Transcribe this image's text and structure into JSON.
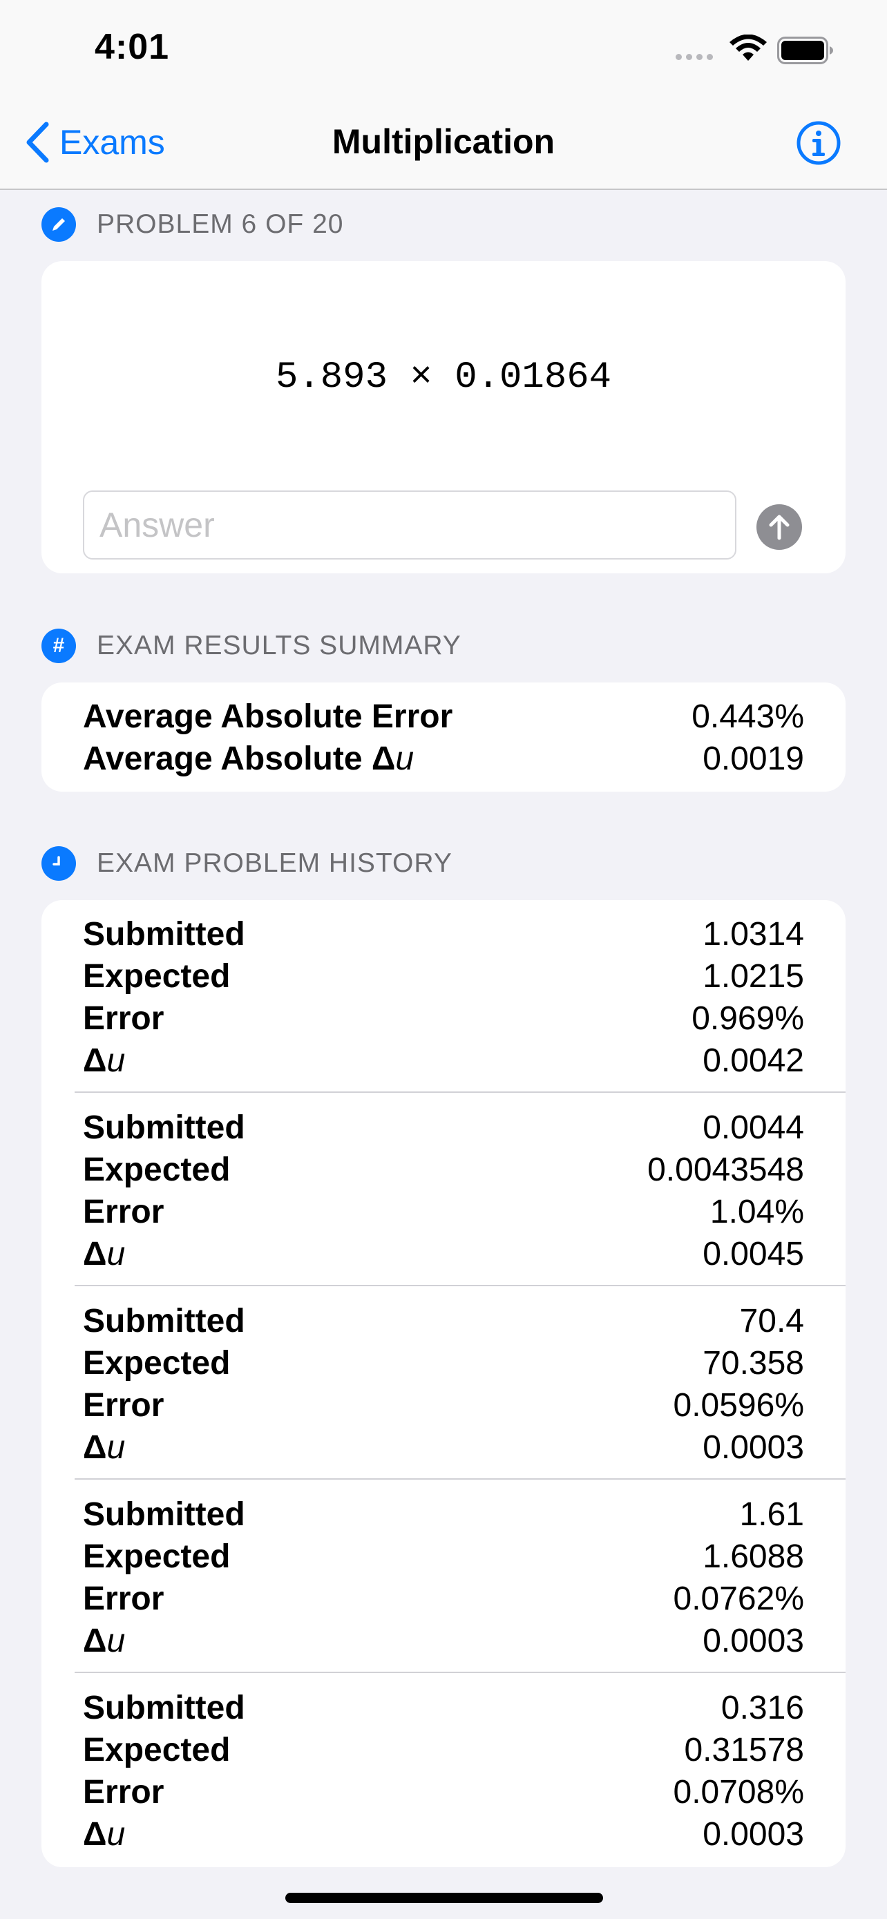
{
  "status": {
    "time": "4:01"
  },
  "nav": {
    "back_label": "Exams",
    "title": "Multiplication",
    "accent": "#0a7aff"
  },
  "problem": {
    "header": "PROBLEM 6 OF 20",
    "expression": "5.893 × 0.01864",
    "answer_placeholder": "Answer",
    "answer_value": ""
  },
  "summary": {
    "header": "EXAM RESULTS SUMMARY",
    "rows": [
      {
        "label": "Average Absolute Error",
        "value": "0.443%"
      },
      {
        "label": "Average Absolute Δ",
        "label_italic": "u",
        "value": "0.0019"
      }
    ]
  },
  "history": {
    "header": "EXAM PROBLEM HISTORY",
    "labels": {
      "submitted": "Submitted",
      "expected": "Expected",
      "error": "Error",
      "delta": "Δ",
      "delta_italic": "u"
    },
    "entries": [
      {
        "submitted": "1.0314",
        "expected": "1.0215",
        "error": "0.969%",
        "delta": "0.0042"
      },
      {
        "submitted": "0.0044",
        "expected": "0.0043548",
        "error": "1.04%",
        "delta": "0.0045"
      },
      {
        "submitted": "70.4",
        "expected": "70.358",
        "error": "0.0596%",
        "delta": "0.0003"
      },
      {
        "submitted": "1.61",
        "expected": "1.6088",
        "error": "0.0762%",
        "delta": "0.0003"
      },
      {
        "submitted": "0.316",
        "expected": "0.31578",
        "error": "0.0708%",
        "delta": "0.0003"
      }
    ]
  }
}
